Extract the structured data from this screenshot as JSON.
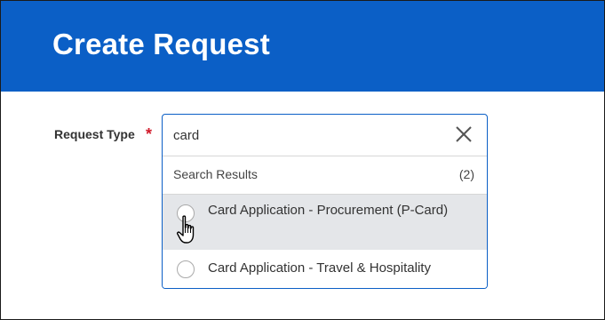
{
  "header": {
    "title": "Create Request"
  },
  "form": {
    "field_label": "Request Type",
    "required_mark": "*"
  },
  "search": {
    "value": "card"
  },
  "results": {
    "title": "Search Results",
    "count": "(2)",
    "items": [
      {
        "label": "Card Application - Procurement (P-Card)",
        "hovered": true
      },
      {
        "label": "Card Application - Travel & Hospitality",
        "hovered": false
      }
    ]
  },
  "colors": {
    "header_bg": "#0b5fc6",
    "focus_border": "#0b5fc6",
    "required": "#d11a2a",
    "hover_bg": "#e4e6e9"
  },
  "icons": {
    "clear": "close-icon",
    "pointer": "hand-pointer-icon"
  }
}
